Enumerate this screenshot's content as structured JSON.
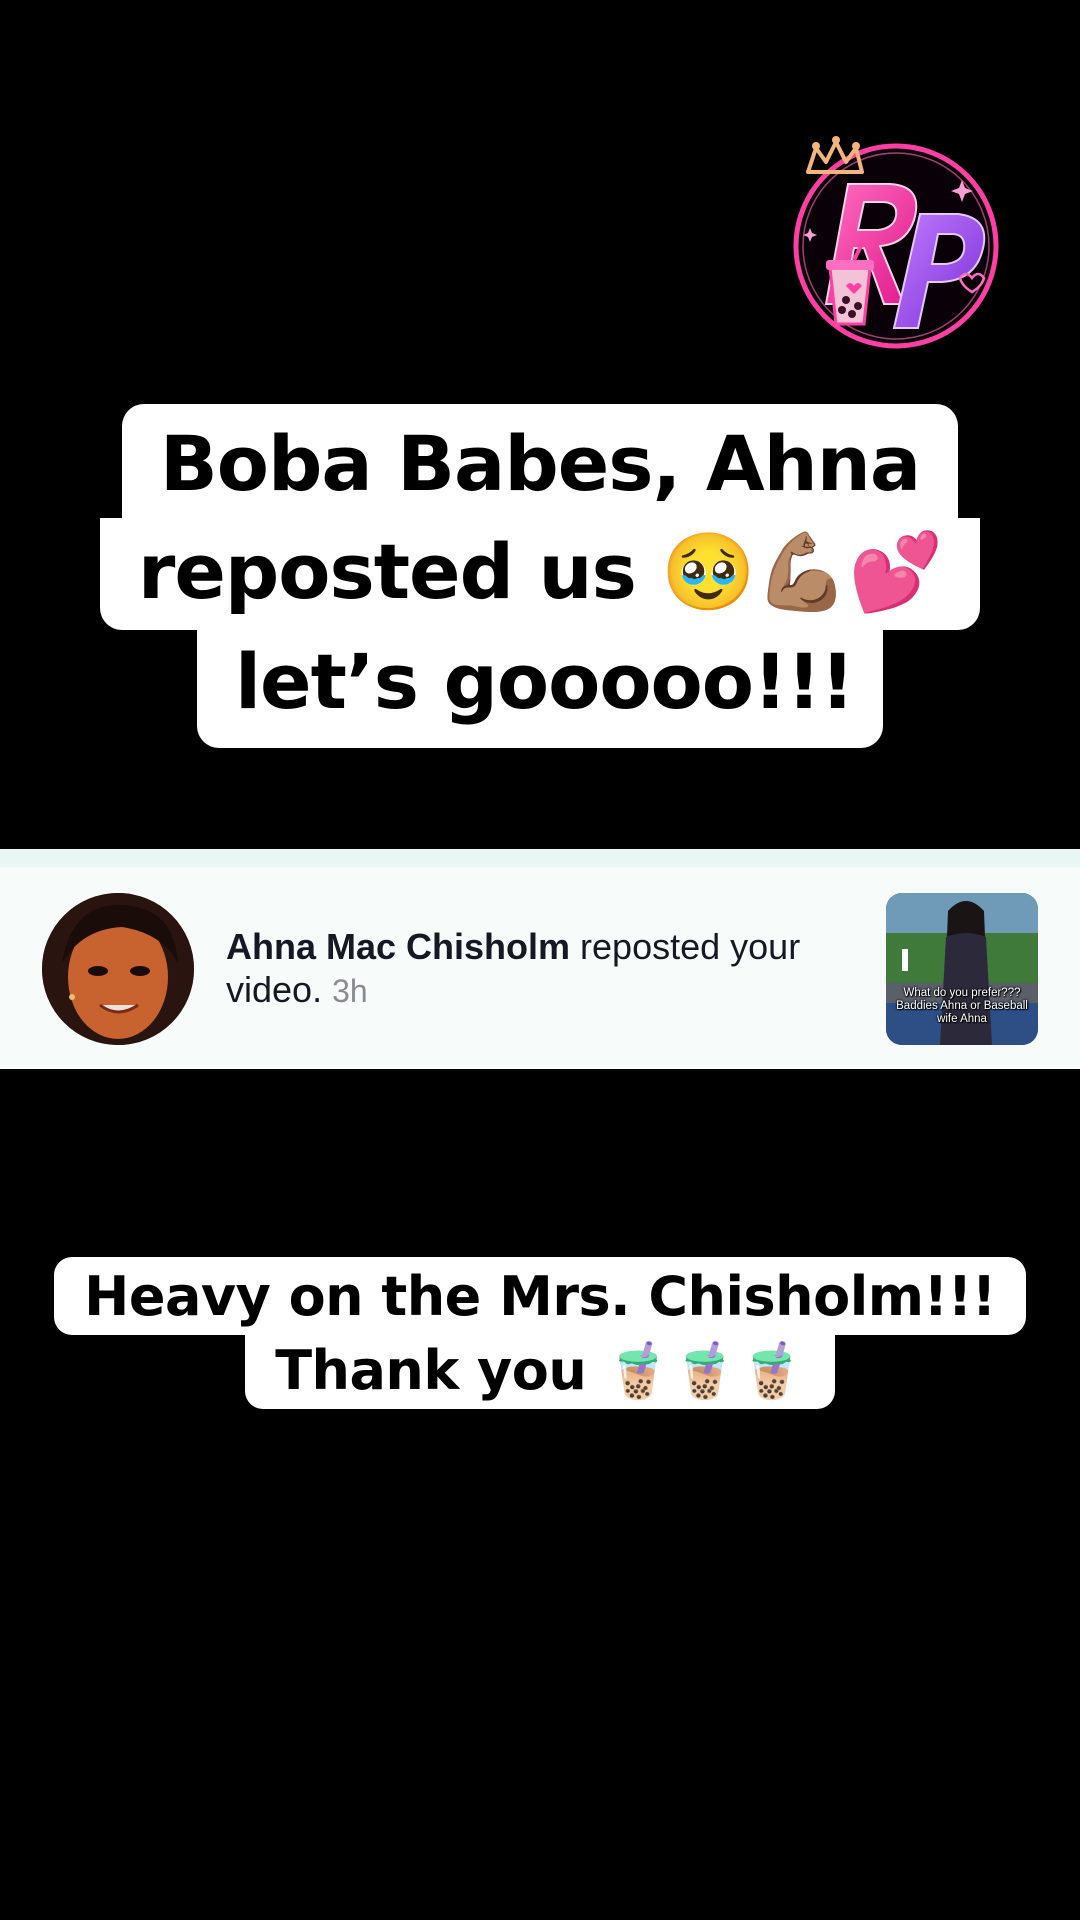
{
  "logo": {
    "text": "RP",
    "colors": {
      "pink": "#ff3fa4",
      "purple": "#a64dff",
      "crown": "#f4b57a"
    }
  },
  "caption_top": {
    "line1": "Boba Babes, Ahna",
    "line2": "reposted us 🥹💪🏽💕",
    "line3": "let’s gooooo!!!"
  },
  "notification": {
    "username": "Ahna Mac Chisholm",
    "action": " reposted your video.",
    "time": "3h",
    "thumbnail_caption": "What do you prefer??? Baddies Ahna or Baseball wife Ahna"
  },
  "caption_bottom": {
    "line1": "Heavy on the Mrs. Chisholm!!!",
    "line2": "Thank you 🧋🧋🧋"
  }
}
